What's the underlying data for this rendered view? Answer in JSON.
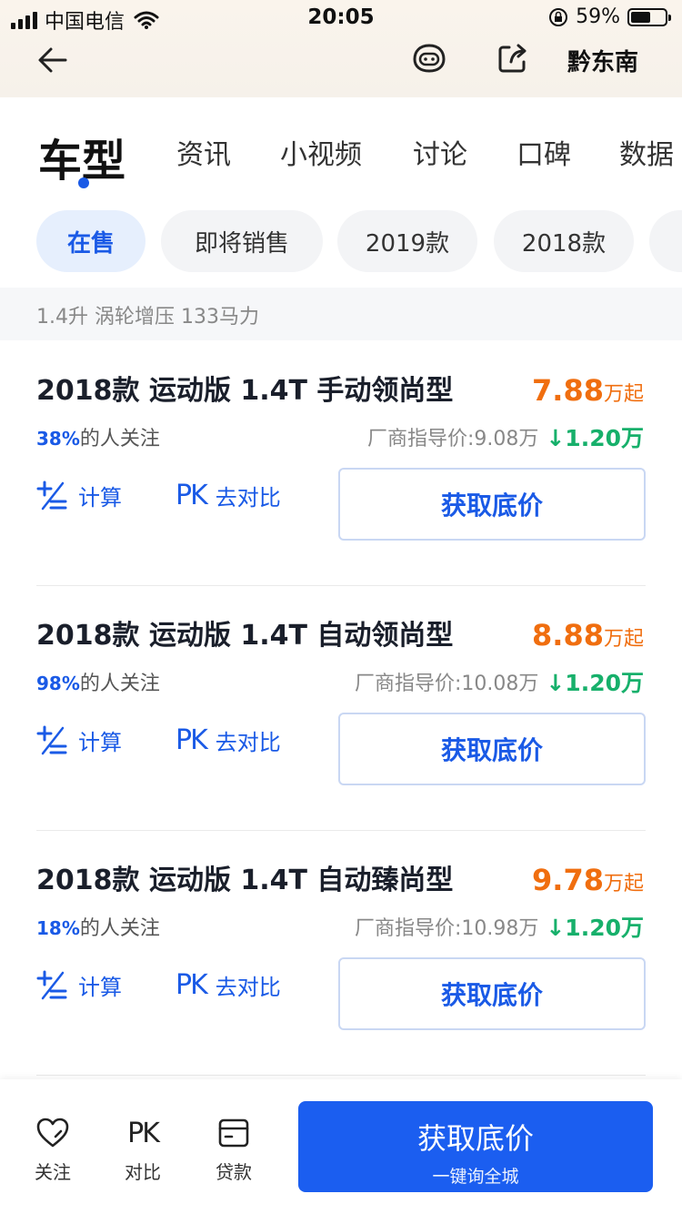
{
  "status_bar": {
    "carrier": "中国电信",
    "time": "20:05",
    "battery": "59%",
    "battery_level": 0.59
  },
  "header": {
    "city": "黔东南",
    "icons": [
      "back-arrow-icon",
      "robot-face-icon",
      "share-icon"
    ]
  },
  "tabs": [
    {
      "label": "车型",
      "active": true
    },
    {
      "label": "资讯"
    },
    {
      "label": "小视频"
    },
    {
      "label": "讨论"
    },
    {
      "label": "口碑"
    },
    {
      "label": "数据"
    }
  ],
  "chips": [
    {
      "label": "在售",
      "active": true
    },
    {
      "label": "即将销售"
    },
    {
      "label": "2019款"
    },
    {
      "label": "2018款"
    }
  ],
  "group_header": "1.4升 涡轮增压 133马力",
  "cars": [
    {
      "name": "2018款 运动版 1.4T 手动领尚型",
      "price": "7.88",
      "price_unit": "万起",
      "follow_pct": "38%",
      "follow_text": "的人关注",
      "guide_price": "厂商指导价:9.08万",
      "drop": "↓1.20万",
      "calc_label": "计算",
      "pk_label": "去对比",
      "cta_label": "获取底价"
    },
    {
      "name": "2018款 运动版 1.4T 自动领尚型",
      "price": "8.88",
      "price_unit": "万起",
      "follow_pct": "98%",
      "follow_text": "的人关注",
      "guide_price": "厂商指导价:10.08万",
      "drop": "↓1.20万",
      "calc_label": "计算",
      "pk_label": "去对比",
      "cta_label": "获取底价"
    },
    {
      "name": "2018款 运动版 1.4T 自动臻尚型",
      "price": "9.78",
      "price_unit": "万起",
      "follow_pct": "18%",
      "follow_text": "的人关注",
      "guide_price": "厂商指导价:10.98万",
      "drop": "↓1.20万",
      "calc_label": "计算",
      "pk_label": "去对比",
      "cta_label": "获取底价"
    }
  ],
  "pk_text": "PK",
  "bottom_bar": {
    "follow_label": "关注",
    "compare_label": "对比",
    "loan_label": "贷款",
    "cta_main": "获取底价",
    "cta_sub": "一键询全城"
  },
  "colors": {
    "accent": "#1a5ae6",
    "price": "#f06e0f",
    "drop": "#17b06b",
    "cta_bg": "#1b5ef0"
  }
}
